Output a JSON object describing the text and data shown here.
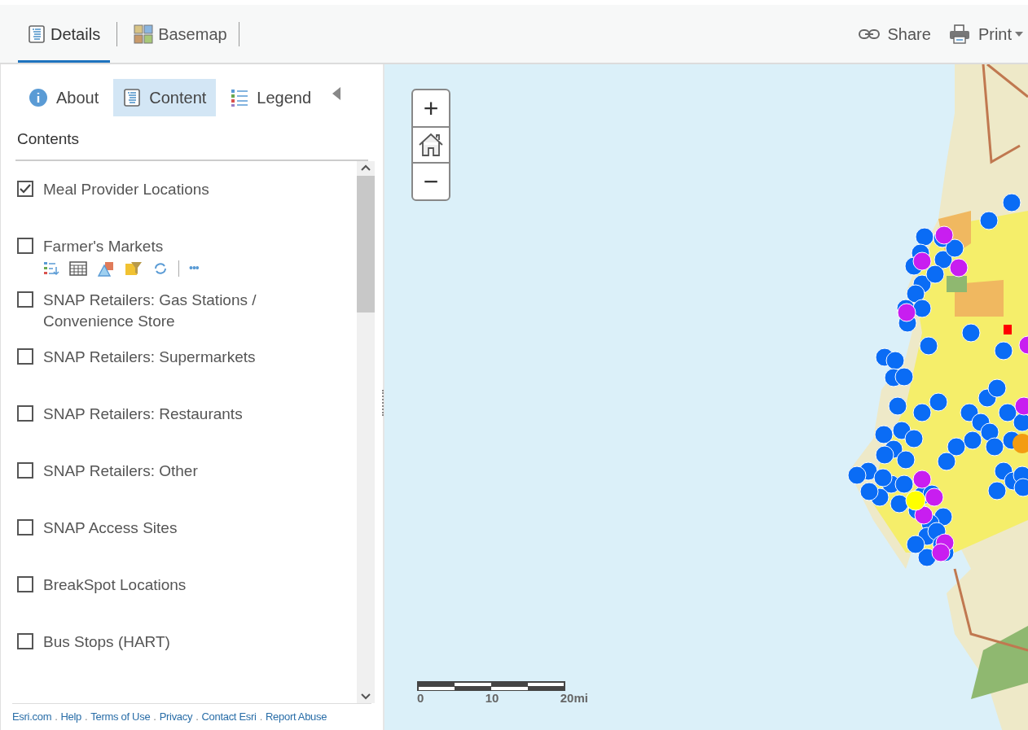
{
  "top_tabs": [
    {
      "label": "Details",
      "selected": true
    },
    {
      "label": "Basemap",
      "selected": false
    }
  ],
  "top_actions": [
    {
      "label": "Share",
      "dropdown": false
    },
    {
      "label": "Print",
      "dropdown": true
    }
  ],
  "panel_tabs": [
    {
      "label": "About",
      "selected": false
    },
    {
      "label": "Content",
      "selected": true
    },
    {
      "label": "Legend",
      "selected": false
    }
  ],
  "contents_heading": "Contents",
  "layers": [
    {
      "label": "Meal Provider Locations",
      "checked": true,
      "show_tools": false
    },
    {
      "label": "Farmer's Markets",
      "checked": false,
      "show_tools": true
    },
    {
      "label": "SNAP Retailers: Gas Stations / Convenience Store",
      "checked": false,
      "show_tools": false
    },
    {
      "label": "SNAP Retailers: Supermarkets",
      "checked": false,
      "show_tools": false
    },
    {
      "label": "SNAP Retailers: Restaurants",
      "checked": false,
      "show_tools": false
    },
    {
      "label": "SNAP Retailers: Other",
      "checked": false,
      "show_tools": false
    },
    {
      "label": "SNAP Access Sites",
      "checked": false,
      "show_tools": false
    },
    {
      "label": "BreakSpot Locations",
      "checked": false,
      "show_tools": false
    },
    {
      "label": "Bus Stops (HART)",
      "checked": false,
      "show_tools": false
    }
  ],
  "layer_tools_more": "•••",
  "footer_links": [
    "Esri.com",
    "Help",
    "Terms of Use",
    "Privacy",
    "Contact Esri",
    "Report Abuse"
  ],
  "footer_separator": ".",
  "map_controls": {
    "zoom_in": "+",
    "zoom_out": "−"
  },
  "scale_bar": {
    "labels": [
      "0",
      "10",
      "20mi"
    ]
  }
}
